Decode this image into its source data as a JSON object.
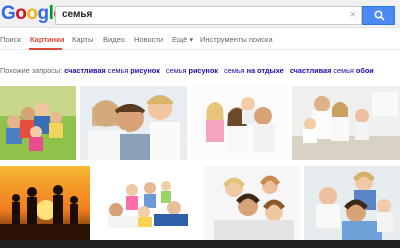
{
  "logo": {
    "letters": [
      "G",
      "o",
      "o",
      "g",
      "l",
      "e"
    ],
    "colors": [
      "#3369e8",
      "#d50f25",
      "#eeb211",
      "#3369e8",
      "#009925",
      "#d50f25"
    ]
  },
  "search": {
    "query": "семья",
    "clear_icon": "×"
  },
  "tabs": [
    {
      "label": "Поиск",
      "active": false
    },
    {
      "label": "Картинки",
      "active": true
    },
    {
      "label": "Карты",
      "active": false
    },
    {
      "label": "Видео",
      "active": false
    },
    {
      "label": "Новости",
      "active": false
    },
    {
      "label": "Ещё ▾",
      "active": false
    },
    {
      "label": "Инструменты поиска",
      "active": false
    }
  ],
  "related": {
    "prefix": "Похожие запросы:",
    "items": [
      {
        "bold1": "счастливая",
        "plain": " семья ",
        "bold2": "рисунок"
      },
      {
        "bold1": "",
        "plain": "семья ",
        "bold2": "рисунок"
      },
      {
        "bold1": "",
        "plain": "семья ",
        "bold2": "на отдыхе"
      },
      {
        "bold1": "счастливая",
        "plain": " семья ",
        "bold2": "обои"
      }
    ]
  },
  "colors": {
    "accent": "#dd4b39",
    "link": "#1a0dab",
    "search_button": "#4a8af4"
  }
}
